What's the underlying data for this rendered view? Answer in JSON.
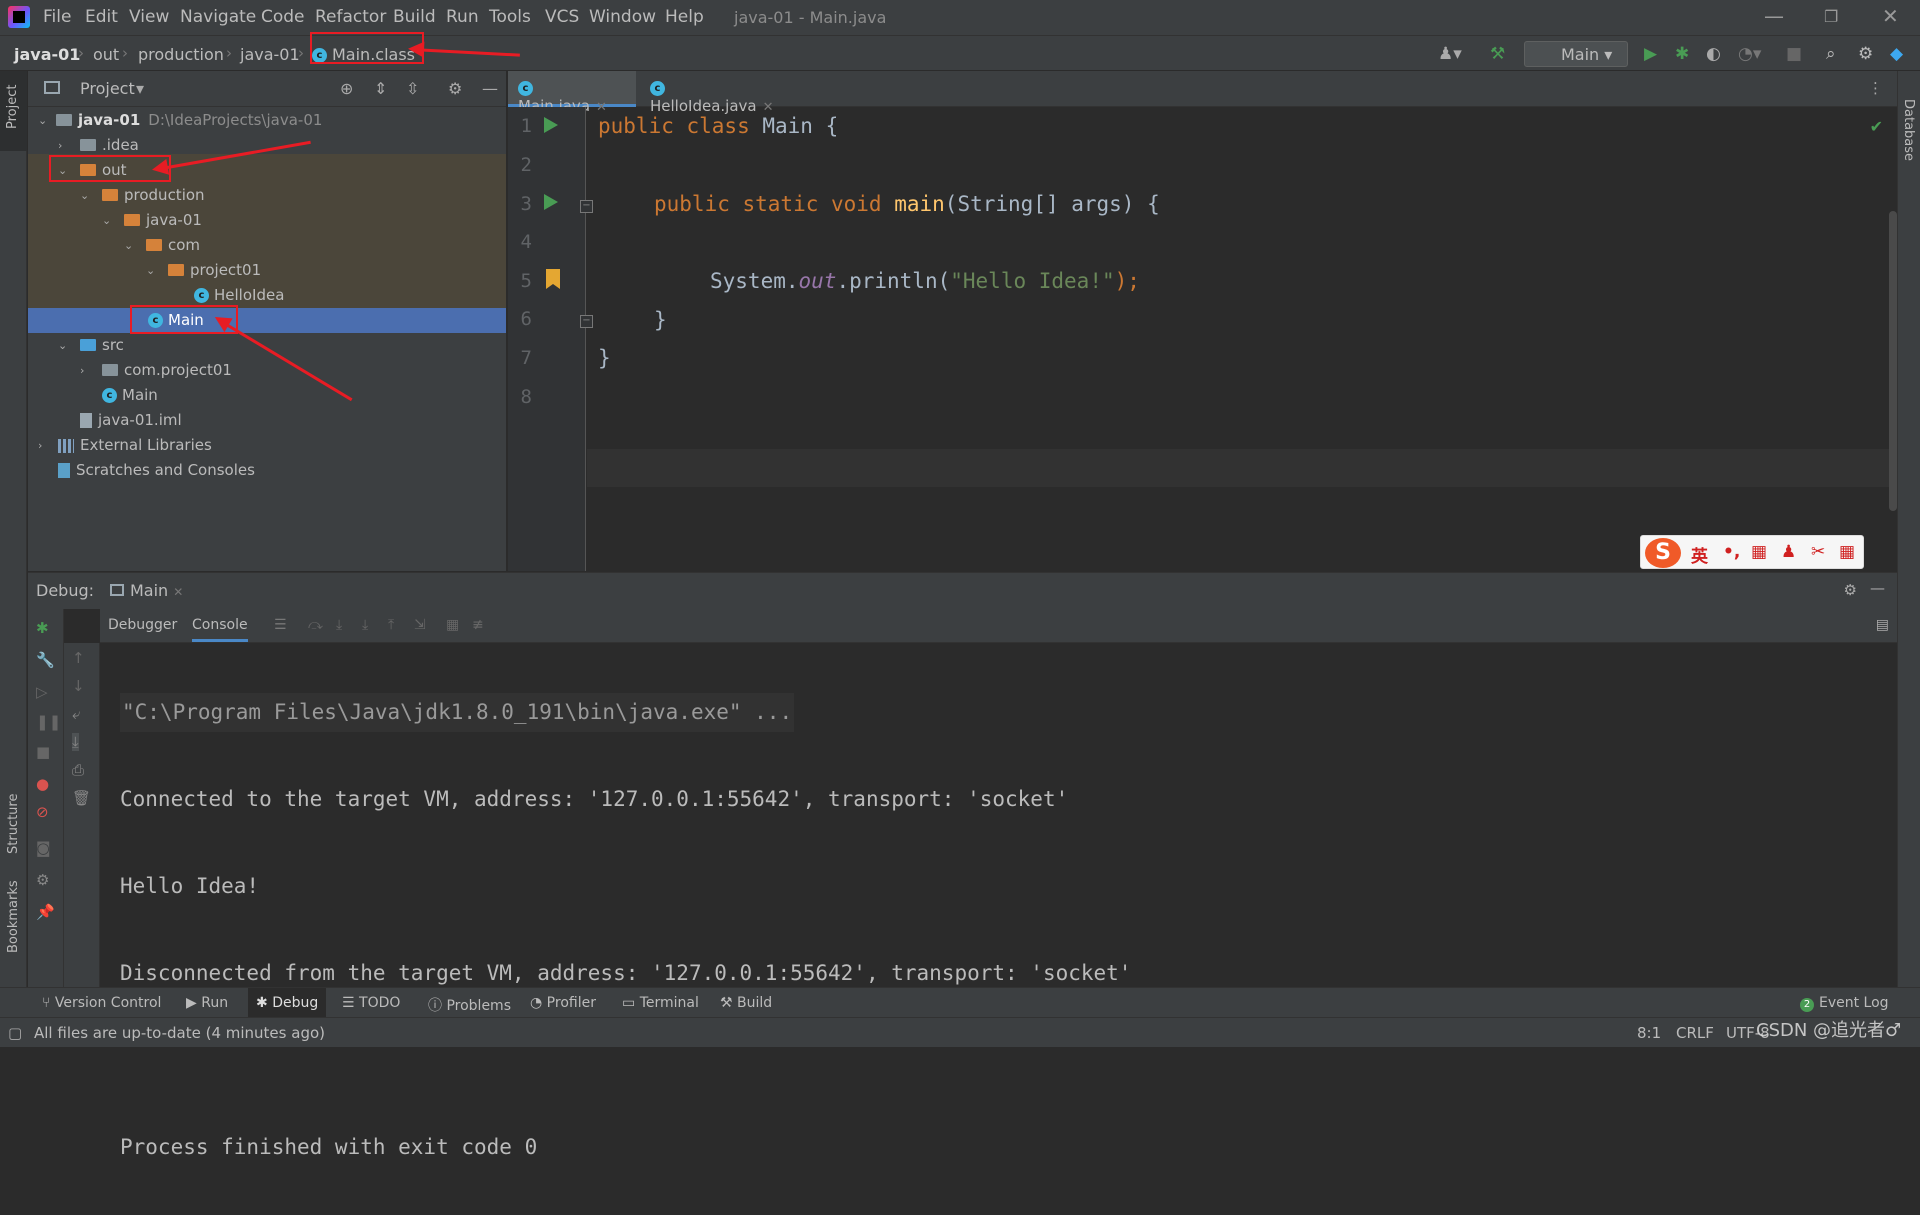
{
  "menubar": {
    "items": [
      "File",
      "Edit",
      "View",
      "Navigate",
      "Code",
      "Refactor",
      "Build",
      "Run",
      "Tools",
      "VCS",
      "Window",
      "Help"
    ],
    "window_title": "java-01 - Main.java"
  },
  "navbar": {
    "breadcrumbs": [
      "java-01",
      "out",
      "production",
      "java-01",
      "Main.class"
    ],
    "run_config": "Main"
  },
  "project_panel": {
    "title": "Project",
    "tree": [
      {
        "label": "java-01",
        "extra": "D:\\IdeaProjects\\java-01",
        "icon": "folder-icon",
        "expanded": true
      },
      {
        "label": ".idea",
        "icon": "folder-icon",
        "expanded": false
      },
      {
        "label": "out",
        "icon": "folder-orange-icon",
        "expanded": true
      },
      {
        "label": "production",
        "icon": "folder-orange-icon",
        "expanded": true
      },
      {
        "label": "java-01",
        "icon": "folder-orange-icon",
        "expanded": true
      },
      {
        "label": "com",
        "icon": "folder-orange-icon",
        "expanded": true
      },
      {
        "label": "project01",
        "icon": "folder-orange-icon",
        "expanded": true
      },
      {
        "label": "HelloIdea",
        "icon": "class-icon"
      },
      {
        "label": "Main",
        "icon": "class-icon",
        "selected": true
      },
      {
        "label": "src",
        "icon": "folder-blue-icon",
        "expanded": true
      },
      {
        "label": "com.project01",
        "icon": "package-icon",
        "expanded": false
      },
      {
        "label": "Main",
        "icon": "class-icon"
      },
      {
        "label": "java-01.iml",
        "icon": "file-icon"
      },
      {
        "label": "External Libraries",
        "icon": "library-icon",
        "expanded": false
      },
      {
        "label": "Scratches and Consoles",
        "icon": "scratch-icon"
      }
    ]
  },
  "editor": {
    "tabs": [
      {
        "label": "Main.java",
        "active": true
      },
      {
        "label": "HelloIdea.java",
        "active": false
      }
    ],
    "line_numbers": [
      "1",
      "2",
      "3",
      "4",
      "5",
      "6",
      "7",
      "8"
    ],
    "code": {
      "l1_kw": "public class ",
      "l1_rest": "Main {",
      "l3_kw": "public static void ",
      "l3_fn": "main",
      "l3_rest": "(String[] args) {",
      "l5_a": "System.",
      "l5_fld": "out",
      "l5_b": ".println(",
      "l5_str": "\"Hello Idea!\"",
      "l5_end": ");",
      "l6": "}",
      "l7": "}"
    }
  },
  "ime": {
    "keys": [
      "英",
      "•,",
      "▦",
      "♟",
      "✂",
      "▦"
    ]
  },
  "debug": {
    "label": "Debug:",
    "tab": "Main",
    "subtabs": [
      "Debugger",
      "Console"
    ],
    "console_lines": [
      "\"C:\\Program Files\\Java\\jdk1.8.0_191\\bin\\java.exe\" ...",
      "Connected to the target VM, address: '127.0.0.1:55642', transport: 'socket'",
      "Hello Idea!",
      "Disconnected from the target VM, address: '127.0.0.1:55642', transport: 'socket'",
      "",
      "Process finished with exit code 0"
    ]
  },
  "side": {
    "project": "Project",
    "structure": "Structure",
    "bookmarks": "Bookmarks",
    "database": "Database"
  },
  "bottom_tools": [
    "Version Control",
    "Run",
    "Debug",
    "TODO",
    "Problems",
    "Profiler",
    "Terminal",
    "Build"
  ],
  "event_log": {
    "count": "2",
    "label": "Event Log"
  },
  "status": {
    "message": "All files are up-to-date (4 minutes ago)",
    "position": "8:1",
    "line_sep": "CRLF",
    "encoding": "UTF-8",
    "watermark": "CSDN @追光者♂"
  }
}
